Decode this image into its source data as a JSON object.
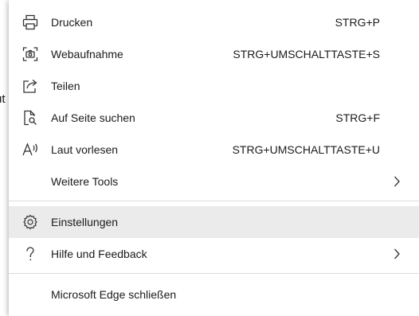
{
  "background": {
    "partial_text": "ut"
  },
  "menu": {
    "items": [
      {
        "label": "Drucken",
        "shortcut": "STRG+P",
        "icon": "printer-icon"
      },
      {
        "label": "Webaufnahme",
        "shortcut": "STRG+UMSCHALTTASTE+S",
        "icon": "web-capture-icon"
      },
      {
        "label": "Teilen",
        "shortcut": "",
        "icon": "share-icon"
      },
      {
        "label": "Auf Seite suchen",
        "shortcut": "STRG+F",
        "icon": "find-on-page-icon"
      },
      {
        "label": "Laut vorlesen",
        "shortcut": "STRG+UMSCHALTTASTE+U",
        "icon": "read-aloud-icon"
      },
      {
        "label": "Weitere Tools",
        "shortcut": "",
        "icon": ""
      },
      {
        "label": "Einstellungen",
        "shortcut": "",
        "icon": "gear-icon"
      },
      {
        "label": "Hilfe und Feedback",
        "shortcut": "",
        "icon": "help-icon"
      },
      {
        "label": "Microsoft Edge schließen",
        "shortcut": "",
        "icon": ""
      }
    ]
  },
  "colors": {
    "hover_background": "#ebebeb",
    "separator": "#dcdcdc",
    "text": "#1b1b1b"
  }
}
